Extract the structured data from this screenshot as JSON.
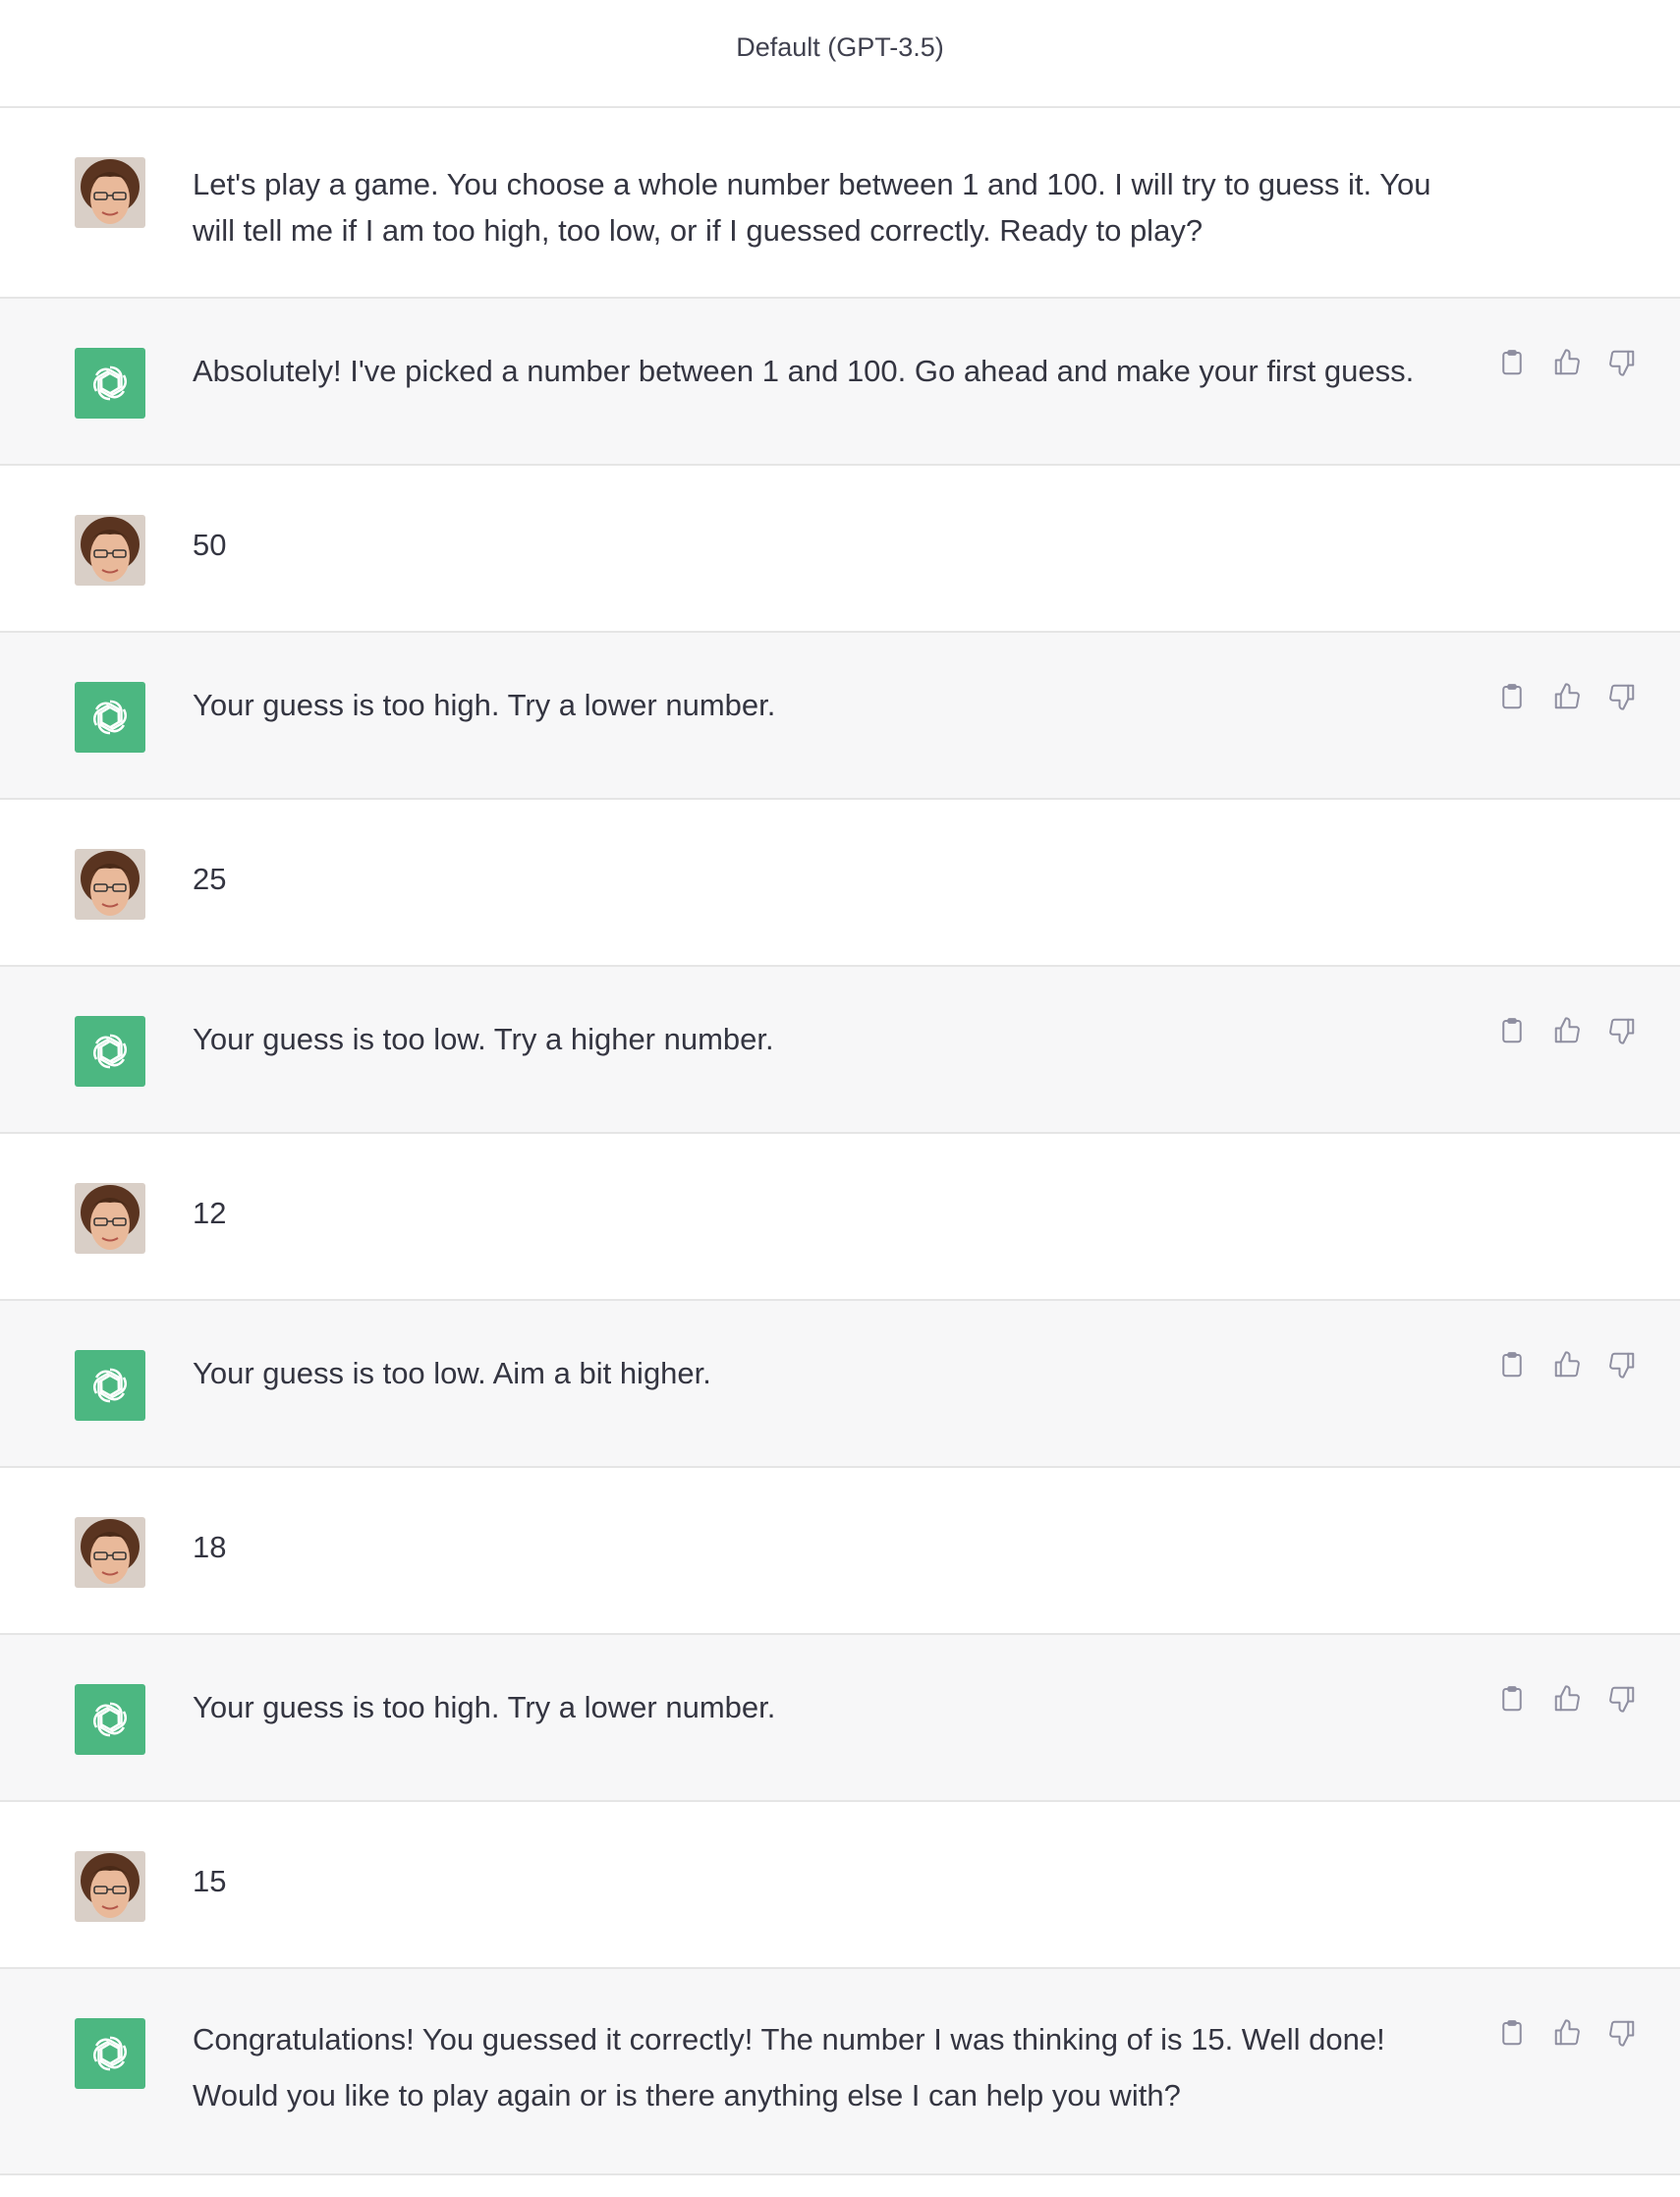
{
  "header": {
    "model": "Default (GPT-3.5)"
  },
  "messages": [
    {
      "role": "user",
      "text": "Let's play a game. You choose a whole number between 1 and 100. I will try to guess it. You will tell me if I am too high, too low, or if I guessed correctly. Ready to play?"
    },
    {
      "role": "assistant",
      "text": "Absolutely! I've picked a number between 1 and 100. Go ahead and make your first guess."
    },
    {
      "role": "user",
      "text": "50"
    },
    {
      "role": "assistant",
      "text": "Your guess is too high. Try a lower number."
    },
    {
      "role": "user",
      "text": "25"
    },
    {
      "role": "assistant",
      "text": "Your guess is too low. Try a higher number."
    },
    {
      "role": "user",
      "text": "12"
    },
    {
      "role": "assistant",
      "text": "Your guess is too low. Aim a bit higher."
    },
    {
      "role": "user",
      "text": "18"
    },
    {
      "role": "assistant",
      "text": "Your guess is too high. Try a lower number."
    },
    {
      "role": "user",
      "text": "15"
    },
    {
      "role": "assistant",
      "text": "Congratulations! You guessed it correctly! The number I was thinking of is 15. Well done! Would you like to play again or is there anything else I can help you with?"
    }
  ],
  "icons": {
    "copy": "clipboard-icon",
    "like": "thumbs-up-icon",
    "dislike": "thumbs-down-icon",
    "bot": "openai-logo-icon"
  },
  "colors": {
    "assistant_bg": "#f7f7f8",
    "bot_avatar": "#4cb781",
    "divider": "#e5e5e5"
  }
}
